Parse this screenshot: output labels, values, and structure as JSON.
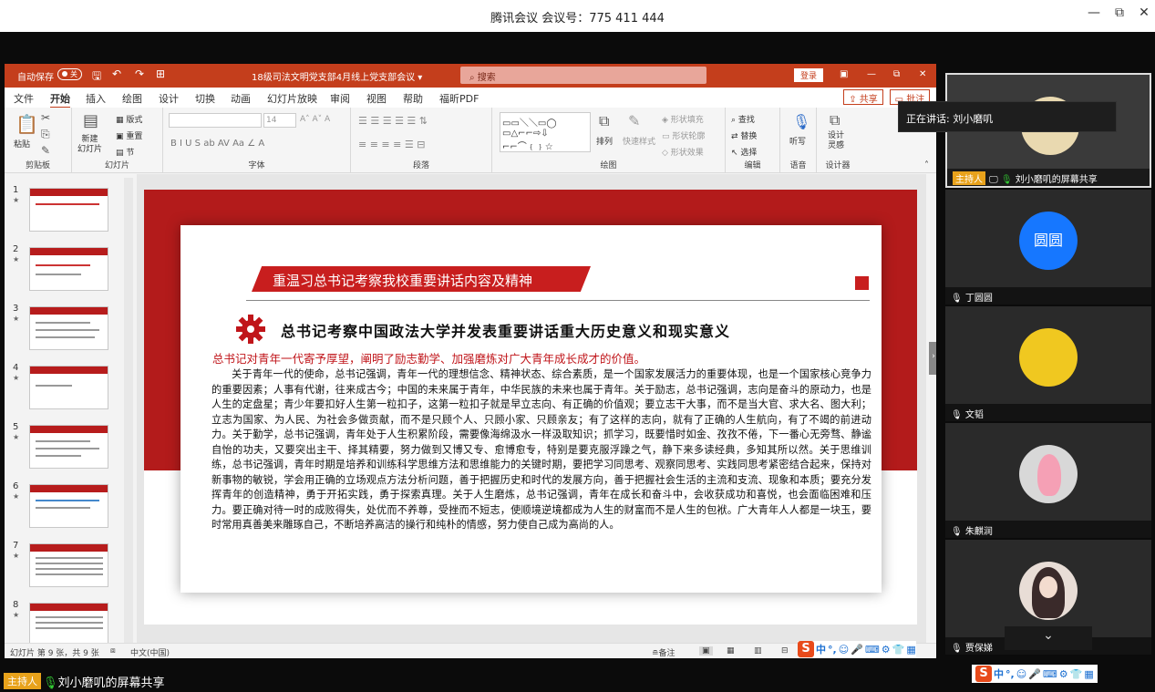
{
  "meeting": {
    "title": "腾讯会议 会议号：775 411 444"
  },
  "ppt": {
    "autosave": "自动保存",
    "autosave_state": "关",
    "file_title": "18级司法文明党支部4月线上党支部会议 ▾",
    "search_placeholder": "搜索",
    "login": "登录",
    "menu": [
      "文件",
      "开始",
      "插入",
      "绘图",
      "设计",
      "切换",
      "动画",
      "幻灯片放映",
      "审阅",
      "视图",
      "帮助",
      "福昕PDF"
    ],
    "share": "共享",
    "comment": "批注",
    "ribbon": {
      "paste": "粘贴",
      "clipboard": "剪贴板",
      "new_slide": "新建\n幻灯片",
      "layout": "版式",
      "reset": "重置",
      "section": "节",
      "slides": "幻灯片",
      "font_size": "14",
      "font": "字体",
      "paragraph": "段落",
      "arrange": "排列",
      "quick_styles": "快速样式",
      "shape_fill": "形状填充",
      "shape_outline": "形状轮廓",
      "shape_effects": "形状效果",
      "drawing": "绘图",
      "find": "查找",
      "replace": "替换",
      "select": "选择",
      "editing": "编辑",
      "dictate": "听写",
      "voice": "语音",
      "designer": "设计\n灵感",
      "designer_group": "设计器"
    },
    "thumbnails": [
      "1",
      "2",
      "3",
      "4",
      "5",
      "6",
      "7",
      "8"
    ],
    "slide": {
      "banner": "重温习总书记考察我校重要讲话内容及精神",
      "heading": "总书记考察中国政法大学并发表重要讲话重大历史意义和现实意义",
      "subheading": "总书记对青年一代寄予厚望，阐明了励志勤学、加强磨炼对广大青年成长成才的价值。",
      "body": "关于青年一代的使命，总书记强调，青年一代的理想信念、精神状态、综合素质，是一个国家发展活力的重要体现，也是一个国家核心竞争力的重要因素；人事有代谢，往来成古今；中国的未来属于青年，中华民族的未来也属于青年。关于励志，总书记强调，志向是奋斗的原动力，也是人生的定盘星；青少年要扣好人生第一粒扣子，这第一粒扣子就是早立志向、有正确的价值观；要立志干大事，而不是当大官、求大名、图大利；立志为国家、为人民、为社会多做贡献，而不是只顾个人、只顾小家、只顾亲友；有了这样的志向，就有了正确的人生航向，有了不竭的前进动力。关于勤学，总书记强调，青年处于人生积累阶段，需要像海绵汲水一样汲取知识；抓学习，既要惜时如金、孜孜不倦，下一番心无旁骛、静谧自怡的功夫，又要突出主干、择其精要，努力做到又博又专、愈博愈专，特别是要克服浮躁之气，静下来多读经典，多知其所以然。关于思维训练，总书记强调，青年时期是培养和训练科学思维方法和思维能力的关键时期，要把学习同思考、观察同思考、实践同思考紧密结合起来，保持对新事物的敏锐，学会用正确的立场观点方法分析问题，善于把握历史和时代的发展方向，善于把握社会生活的主流和支流、现象和本质；要充分发挥青年的创造精神，勇于开拓实践，勇于探索真理。关于人生磨炼，总书记强调，青年在成长和奋斗中，会收获成功和喜悦，也会面临困难和压力。要正确对待一时的成败得失，处优而不养尊，受挫而不短志，使顺境逆境都成为人生的财富而不是人生的包袱。广大青年人人都是一块玉，要时常用真善美来雕琢自己，不断培养高洁的操行和纯朴的情感，努力使自己成为高尚的人。"
    },
    "status": {
      "slide_count": "幻灯片 第 9 张，共 9 张",
      "language": "中文(中国)",
      "notes": "备注"
    }
  },
  "ime": {
    "label": "中"
  },
  "participants": [
    {
      "name": "刘小磨叽的屏幕共享",
      "host": "主持人"
    },
    {
      "name": "丁圆圆",
      "avatar_text": "圆圆"
    },
    {
      "name": "文韬"
    },
    {
      "name": "朱麒润"
    },
    {
      "name": "贾保娣"
    }
  ],
  "tooltip": "正在讲话: 刘小磨叽",
  "bottom": {
    "host": "主持人",
    "share_text": "刘小磨叽的屏幕共享"
  },
  "colors": {
    "ppt_red": "#c43e1c",
    "slide_red": "#b31b1b",
    "host_badge": "#e8a21b",
    "avatar_blue": "#1677ff"
  }
}
